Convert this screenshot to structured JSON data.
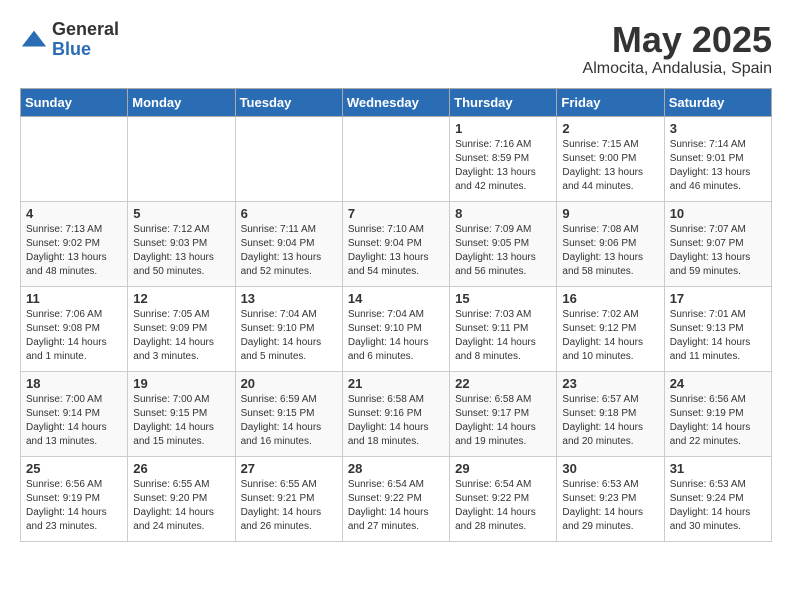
{
  "logo": {
    "general": "General",
    "blue": "Blue"
  },
  "title": "May 2025",
  "location": "Almocita, Andalusia, Spain",
  "days_of_week": [
    "Sunday",
    "Monday",
    "Tuesday",
    "Wednesday",
    "Thursday",
    "Friday",
    "Saturday"
  ],
  "weeks": [
    [
      {
        "day": "",
        "content": ""
      },
      {
        "day": "",
        "content": ""
      },
      {
        "day": "",
        "content": ""
      },
      {
        "day": "",
        "content": ""
      },
      {
        "day": "1",
        "content": "Sunrise: 7:16 AM\nSunset: 8:59 PM\nDaylight: 13 hours\nand 42 minutes."
      },
      {
        "day": "2",
        "content": "Sunrise: 7:15 AM\nSunset: 9:00 PM\nDaylight: 13 hours\nand 44 minutes."
      },
      {
        "day": "3",
        "content": "Sunrise: 7:14 AM\nSunset: 9:01 PM\nDaylight: 13 hours\nand 46 minutes."
      }
    ],
    [
      {
        "day": "4",
        "content": "Sunrise: 7:13 AM\nSunset: 9:02 PM\nDaylight: 13 hours\nand 48 minutes."
      },
      {
        "day": "5",
        "content": "Sunrise: 7:12 AM\nSunset: 9:03 PM\nDaylight: 13 hours\nand 50 minutes."
      },
      {
        "day": "6",
        "content": "Sunrise: 7:11 AM\nSunset: 9:04 PM\nDaylight: 13 hours\nand 52 minutes."
      },
      {
        "day": "7",
        "content": "Sunrise: 7:10 AM\nSunset: 9:04 PM\nDaylight: 13 hours\nand 54 minutes."
      },
      {
        "day": "8",
        "content": "Sunrise: 7:09 AM\nSunset: 9:05 PM\nDaylight: 13 hours\nand 56 minutes."
      },
      {
        "day": "9",
        "content": "Sunrise: 7:08 AM\nSunset: 9:06 PM\nDaylight: 13 hours\nand 58 minutes."
      },
      {
        "day": "10",
        "content": "Sunrise: 7:07 AM\nSunset: 9:07 PM\nDaylight: 13 hours\nand 59 minutes."
      }
    ],
    [
      {
        "day": "11",
        "content": "Sunrise: 7:06 AM\nSunset: 9:08 PM\nDaylight: 14 hours\nand 1 minute."
      },
      {
        "day": "12",
        "content": "Sunrise: 7:05 AM\nSunset: 9:09 PM\nDaylight: 14 hours\nand 3 minutes."
      },
      {
        "day": "13",
        "content": "Sunrise: 7:04 AM\nSunset: 9:10 PM\nDaylight: 14 hours\nand 5 minutes."
      },
      {
        "day": "14",
        "content": "Sunrise: 7:04 AM\nSunset: 9:10 PM\nDaylight: 14 hours\nand 6 minutes."
      },
      {
        "day": "15",
        "content": "Sunrise: 7:03 AM\nSunset: 9:11 PM\nDaylight: 14 hours\nand 8 minutes."
      },
      {
        "day": "16",
        "content": "Sunrise: 7:02 AM\nSunset: 9:12 PM\nDaylight: 14 hours\nand 10 minutes."
      },
      {
        "day": "17",
        "content": "Sunrise: 7:01 AM\nSunset: 9:13 PM\nDaylight: 14 hours\nand 11 minutes."
      }
    ],
    [
      {
        "day": "18",
        "content": "Sunrise: 7:00 AM\nSunset: 9:14 PM\nDaylight: 14 hours\nand 13 minutes."
      },
      {
        "day": "19",
        "content": "Sunrise: 7:00 AM\nSunset: 9:15 PM\nDaylight: 14 hours\nand 15 minutes."
      },
      {
        "day": "20",
        "content": "Sunrise: 6:59 AM\nSunset: 9:15 PM\nDaylight: 14 hours\nand 16 minutes."
      },
      {
        "day": "21",
        "content": "Sunrise: 6:58 AM\nSunset: 9:16 PM\nDaylight: 14 hours\nand 18 minutes."
      },
      {
        "day": "22",
        "content": "Sunrise: 6:58 AM\nSunset: 9:17 PM\nDaylight: 14 hours\nand 19 minutes."
      },
      {
        "day": "23",
        "content": "Sunrise: 6:57 AM\nSunset: 9:18 PM\nDaylight: 14 hours\nand 20 minutes."
      },
      {
        "day": "24",
        "content": "Sunrise: 6:56 AM\nSunset: 9:19 PM\nDaylight: 14 hours\nand 22 minutes."
      }
    ],
    [
      {
        "day": "25",
        "content": "Sunrise: 6:56 AM\nSunset: 9:19 PM\nDaylight: 14 hours\nand 23 minutes."
      },
      {
        "day": "26",
        "content": "Sunrise: 6:55 AM\nSunset: 9:20 PM\nDaylight: 14 hours\nand 24 minutes."
      },
      {
        "day": "27",
        "content": "Sunrise: 6:55 AM\nSunset: 9:21 PM\nDaylight: 14 hours\nand 26 minutes."
      },
      {
        "day": "28",
        "content": "Sunrise: 6:54 AM\nSunset: 9:22 PM\nDaylight: 14 hours\nand 27 minutes."
      },
      {
        "day": "29",
        "content": "Sunrise: 6:54 AM\nSunset: 9:22 PM\nDaylight: 14 hours\nand 28 minutes."
      },
      {
        "day": "30",
        "content": "Sunrise: 6:53 AM\nSunset: 9:23 PM\nDaylight: 14 hours\nand 29 minutes."
      },
      {
        "day": "31",
        "content": "Sunrise: 6:53 AM\nSunset: 9:24 PM\nDaylight: 14 hours\nand 30 minutes."
      }
    ]
  ]
}
